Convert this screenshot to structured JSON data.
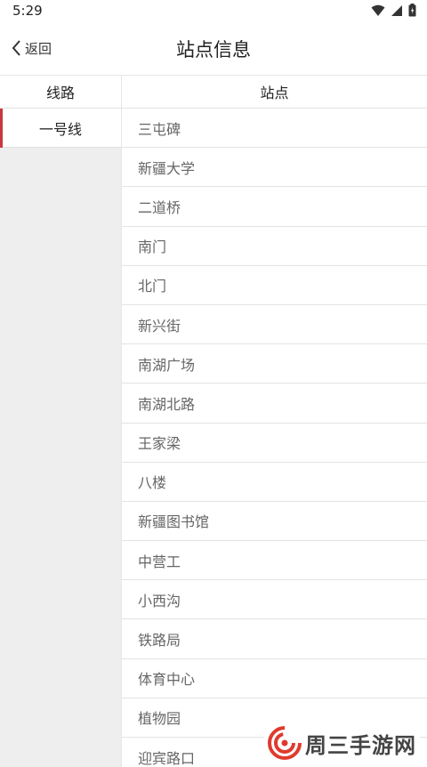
{
  "status_bar": {
    "time": "5:29"
  },
  "header": {
    "back_label": "返回",
    "title": "站点信息"
  },
  "columns": {
    "route": "线路",
    "station": "站点"
  },
  "routes": [
    {
      "label": "一号线",
      "active": true
    }
  ],
  "stations": [
    "三屯碑",
    "新疆大学",
    "二道桥",
    "南门",
    "北门",
    "新兴街",
    "南湖广场",
    "南湖北路",
    "王家梁",
    "八楼",
    "新疆图书馆",
    "中营工",
    "小西沟",
    "铁路局",
    "体育中心",
    "植物园",
    "迎宾路口"
  ],
  "watermark": {
    "text": "周三手游网"
  },
  "colors": {
    "accent": "#c9373f",
    "side_bg": "#eeeeee"
  }
}
